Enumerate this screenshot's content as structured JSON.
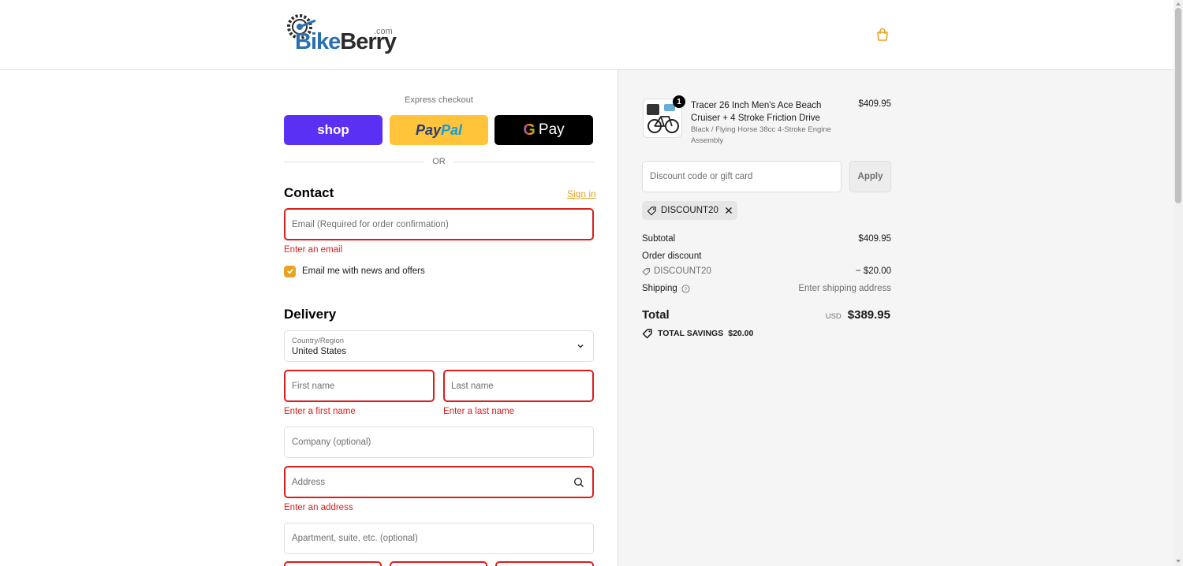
{
  "header": {
    "logo_brand_part1": "Bike",
    "logo_brand_part2": "Berry",
    "logo_suffix": ".com",
    "cart_icon": "shopping-bag-icon"
  },
  "express": {
    "label": "Express checkout",
    "shop_label": "shop",
    "paypal_part1": "Pay",
    "paypal_part2": "Pal",
    "gpay_label": "Pay",
    "or_label": "OR"
  },
  "contact": {
    "title": "Contact",
    "sign_in": "Sign in",
    "email_placeholder": "Email (Required for order confirmation)",
    "email_error": "Enter an email",
    "news_label": "Email me with news and offers",
    "news_checked": true
  },
  "delivery": {
    "title": "Delivery",
    "country_label": "Country/Region",
    "country_value": "United States",
    "first_name_placeholder": "First name",
    "first_name_error": "Enter a first name",
    "last_name_placeholder": "Last name",
    "last_name_error": "Enter a last name",
    "company_placeholder": "Company (optional)",
    "address_placeholder": "Address",
    "address_error": "Enter an address",
    "apartment_placeholder": "Apartment, suite, etc. (optional)"
  },
  "summary": {
    "product": {
      "name": "Tracer 26 Inch Men's Ace Beach Cruiser + 4 Stroke Friction Drive",
      "variant": "Black / Flying Horse 38cc 4-Stroke Engine Assembly",
      "price": "$409.95",
      "quantity": "1"
    },
    "discount_placeholder": "Discount code or gift card",
    "apply_label": "Apply",
    "applied_code": "DISCOUNT20",
    "subtotal_label": "Subtotal",
    "subtotal_value": "$409.95",
    "order_discount_label": "Order discount",
    "order_discount_code": "DISCOUNT20",
    "order_discount_value": "− $20.00",
    "shipping_label": "Shipping",
    "shipping_value": "Enter shipping address",
    "total_label": "Total",
    "total_currency": "USD",
    "total_value": "$389.95",
    "savings_label": "TOTAL SAVINGS",
    "savings_value": "$20.00"
  },
  "colors": {
    "accent": "#e8a322",
    "error": "#dd1d1d",
    "shop_pay": "#5a31f4",
    "paypal": "#ffc439",
    "gpay": "#000000"
  }
}
